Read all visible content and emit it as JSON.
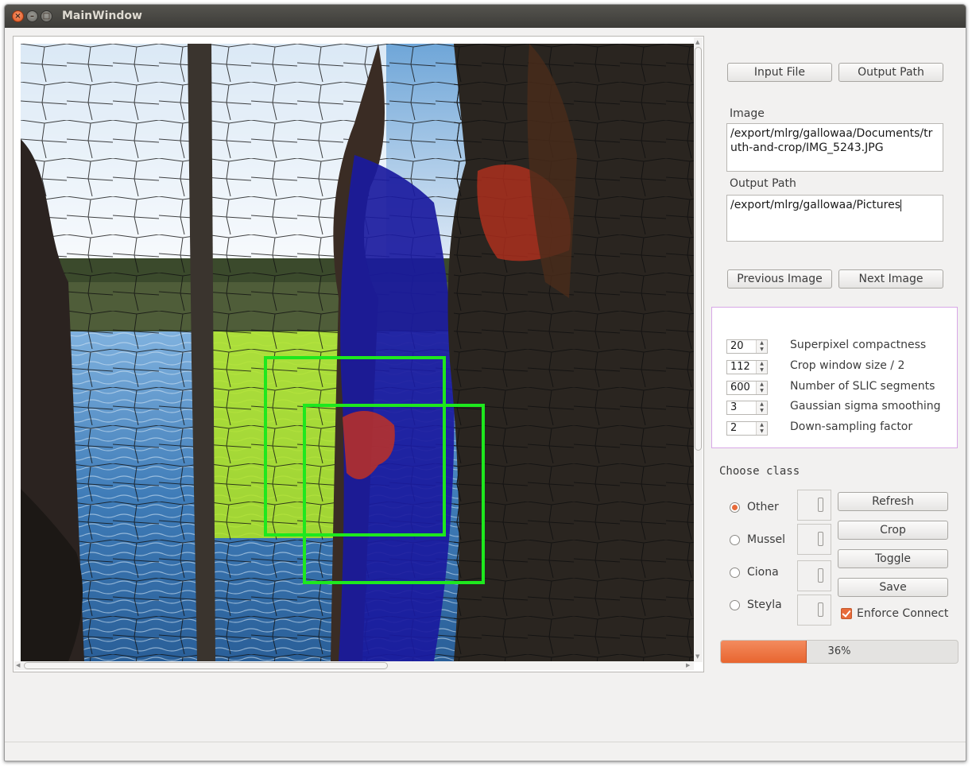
{
  "window": {
    "title": "MainWindow"
  },
  "buttons": {
    "input_file": "Input File",
    "output_path": "Output Path",
    "previous_image": "Previous Image",
    "next_image": "Next Image",
    "refresh": "Refresh",
    "crop": "Crop",
    "toggle": "Toggle",
    "save": "Save"
  },
  "fields": {
    "image_label": "Image",
    "image_value": "/export/mlrg/gallowaa/Documents/truth-and-crop/IMG_5243.JPG",
    "output_label": "Output Path",
    "output_value": "/export/mlrg/gallowaa/Pictures"
  },
  "params": [
    {
      "value": "20",
      "label": "Superpixel compactness"
    },
    {
      "value": "112",
      "label": "Crop window size / 2"
    },
    {
      "value": "600",
      "label": "Number of SLIC segments"
    },
    {
      "value": "3",
      "label": "Gaussian sigma smoothing"
    },
    {
      "value": "2",
      "label": "Down-sampling factor"
    }
  ],
  "classes": {
    "heading": "Choose class",
    "selected": "Other",
    "items": [
      {
        "label": "Other",
        "count": "0"
      },
      {
        "label": "Mussel",
        "count": "0"
      },
      {
        "label": "Ciona",
        "count": "0"
      },
      {
        "label": "Steyla",
        "count": "0"
      }
    ]
  },
  "enforce_connect": {
    "label": "Enforce Connect",
    "checked": true
  },
  "progress": {
    "value": 36,
    "text": "36%"
  },
  "colors": {
    "accent": "#e8652f",
    "crop_box": "#1ee81e",
    "mask_blue": "#1a1a9e",
    "mask_green": "#b4e61e",
    "mask_red": "#c8321e"
  }
}
